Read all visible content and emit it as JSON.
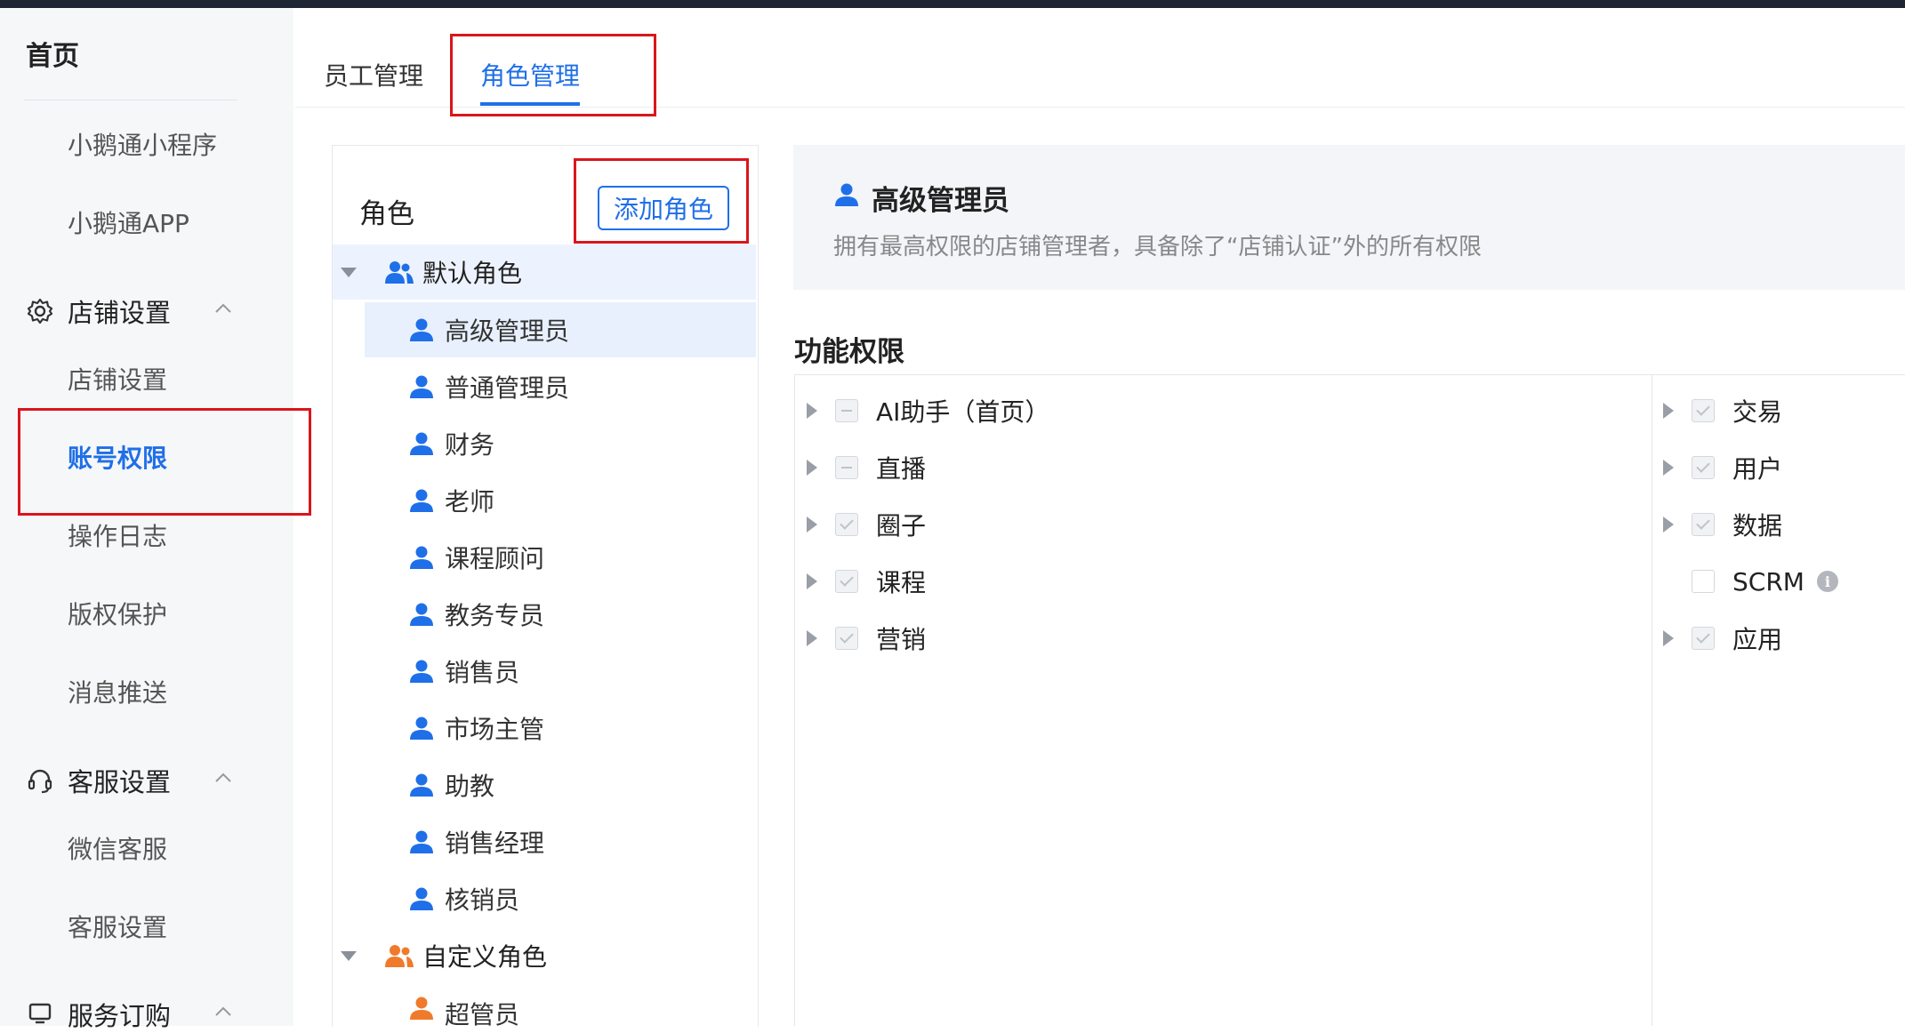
{
  "sidebar": {
    "home": "首页",
    "items": [
      {
        "label": "小鹅通小程序"
      },
      {
        "label": "小鹅通APP"
      }
    ],
    "groups": [
      {
        "label": "店铺设置",
        "icon": "gear-icon",
        "items": [
          "店铺设置",
          "账号权限",
          "操作日志",
          "版权保护",
          "消息推送"
        ]
      },
      {
        "label": "客服设置",
        "icon": "headset-icon",
        "items": [
          "微信客服",
          "客服设置"
        ]
      },
      {
        "label": "服务订购",
        "icon": "cart-icon"
      }
    ],
    "active_item": "账号权限"
  },
  "tabs": [
    {
      "label": "员工管理"
    },
    {
      "label": "角色管理"
    }
  ],
  "role_panel": {
    "title": "角色",
    "add_button": "添加角色",
    "default_group": {
      "label": "默认角色",
      "roles": [
        "高级管理员",
        "普通管理员",
        "财务",
        "老师",
        "课程顾问",
        "教务专员",
        "销售员",
        "市场主管",
        "助教",
        "销售经理",
        "核销员"
      ]
    },
    "custom_group": {
      "label": "自定义角色",
      "roles": [
        "超管员"
      ]
    }
  },
  "role_detail": {
    "title": "高级管理员",
    "description": "拥有最高权限的店铺管理者，具备除了“店铺认证”外的所有权限"
  },
  "function_permissions": {
    "title": "功能权限",
    "left": [
      {
        "label": "AI助手（首页）",
        "state": "partial"
      },
      {
        "label": "直播",
        "state": "partial"
      },
      {
        "label": "圈子",
        "state": "checked"
      },
      {
        "label": "课程",
        "state": "checked"
      },
      {
        "label": "营销",
        "state": "checked"
      }
    ],
    "right": [
      {
        "label": "交易",
        "state": "checked"
      },
      {
        "label": "用户",
        "state": "checked"
      },
      {
        "label": "数据",
        "state": "checked"
      },
      {
        "label": "SCRM",
        "state": "empty"
      },
      {
        "label": "应用",
        "state": "checked"
      }
    ]
  },
  "colors": {
    "accent": "#1f6fe8",
    "highlight": "#d9161c",
    "custom_role": "#f07a2b"
  }
}
